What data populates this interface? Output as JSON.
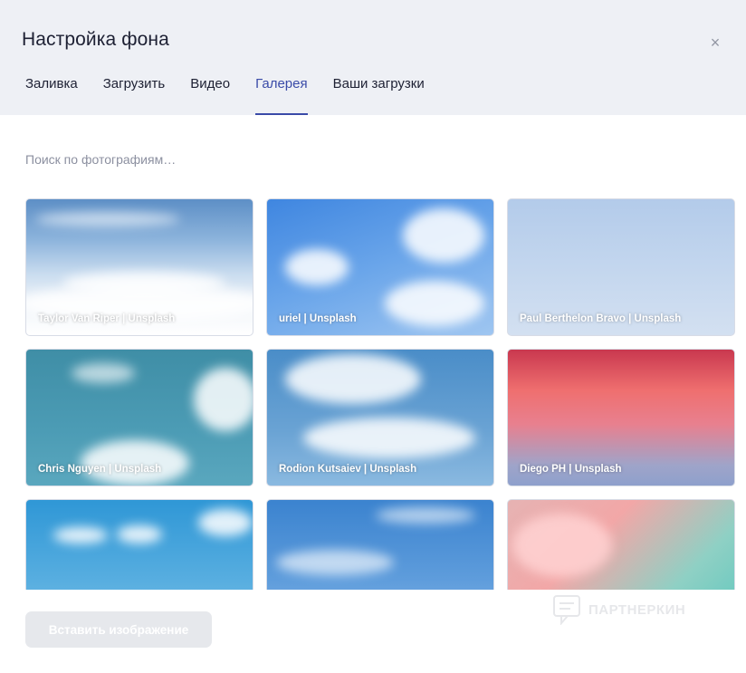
{
  "dialog": {
    "title": "Настройка фона",
    "close_glyph": "×"
  },
  "tabs": [
    {
      "label": "Заливка"
    },
    {
      "label": "Загрузить"
    },
    {
      "label": "Видео"
    },
    {
      "label": "Галерея",
      "active": true
    },
    {
      "label": "Ваши загрузки"
    }
  ],
  "search": {
    "placeholder": "Поиск по фотографиям…",
    "value": ""
  },
  "gallery": [
    {
      "credit": "Taylor Van Riper  |  Unsplash"
    },
    {
      "credit": "uriel  |  Unsplash"
    },
    {
      "credit": "Paul Berthelon Bravo  |  Unsplash"
    },
    {
      "credit": "Chris Nguyen  |  Unsplash"
    },
    {
      "credit": "Rodion Kutsaiev  |  Unsplash"
    },
    {
      "credit": "Diego PH  |  Unsplash"
    },
    {
      "credit": ""
    },
    {
      "credit": ""
    },
    {
      "credit": ""
    }
  ],
  "footer": {
    "insert_label": "Вставить изображение"
  },
  "watermark": {
    "text": "ПАРТНЕРКИН"
  },
  "colors": {
    "accent": "#3a4ba8",
    "header_bg": "#eef0f5",
    "button_disabled": "#e6e8ec"
  }
}
